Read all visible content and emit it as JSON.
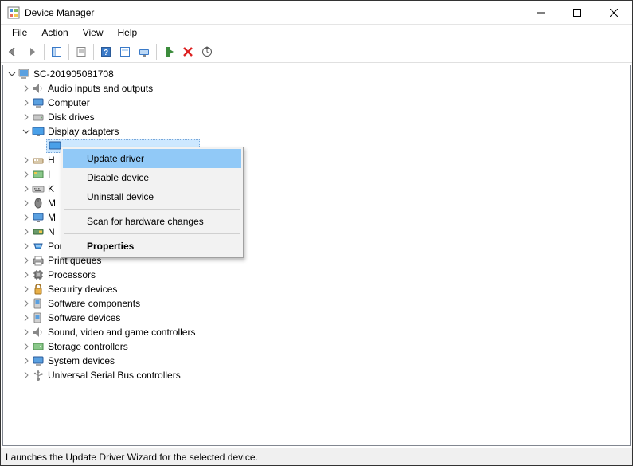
{
  "window": {
    "title": "Device Manager"
  },
  "menu": {
    "file": "File",
    "action": "Action",
    "view": "View",
    "help": "Help"
  },
  "tree": {
    "root": "SC-201905081708",
    "nodes": {
      "audio": "Audio inputs and outputs",
      "computer": "Computer",
      "disk": "Disk drives",
      "display": "Display adapters",
      "hid": "H",
      "ide": "I",
      "keyboard": "K",
      "mouse": "M",
      "monitor": "M",
      "network": "N",
      "ports": "Ports (COM & LPT)",
      "print": "Print queues",
      "processors": "Processors",
      "security": "Security devices",
      "swcomp": "Software components",
      "swdev": "Software devices",
      "sound": "Sound, video and game controllers",
      "storage": "Storage controllers",
      "system": "System devices",
      "usb": "Universal Serial Bus controllers"
    }
  },
  "context_menu": {
    "update": "Update driver",
    "disable": "Disable device",
    "uninstall": "Uninstall device",
    "scan": "Scan for hardware changes",
    "properties": "Properties"
  },
  "statusbar": {
    "text": "Launches the Update Driver Wizard for the selected device."
  }
}
